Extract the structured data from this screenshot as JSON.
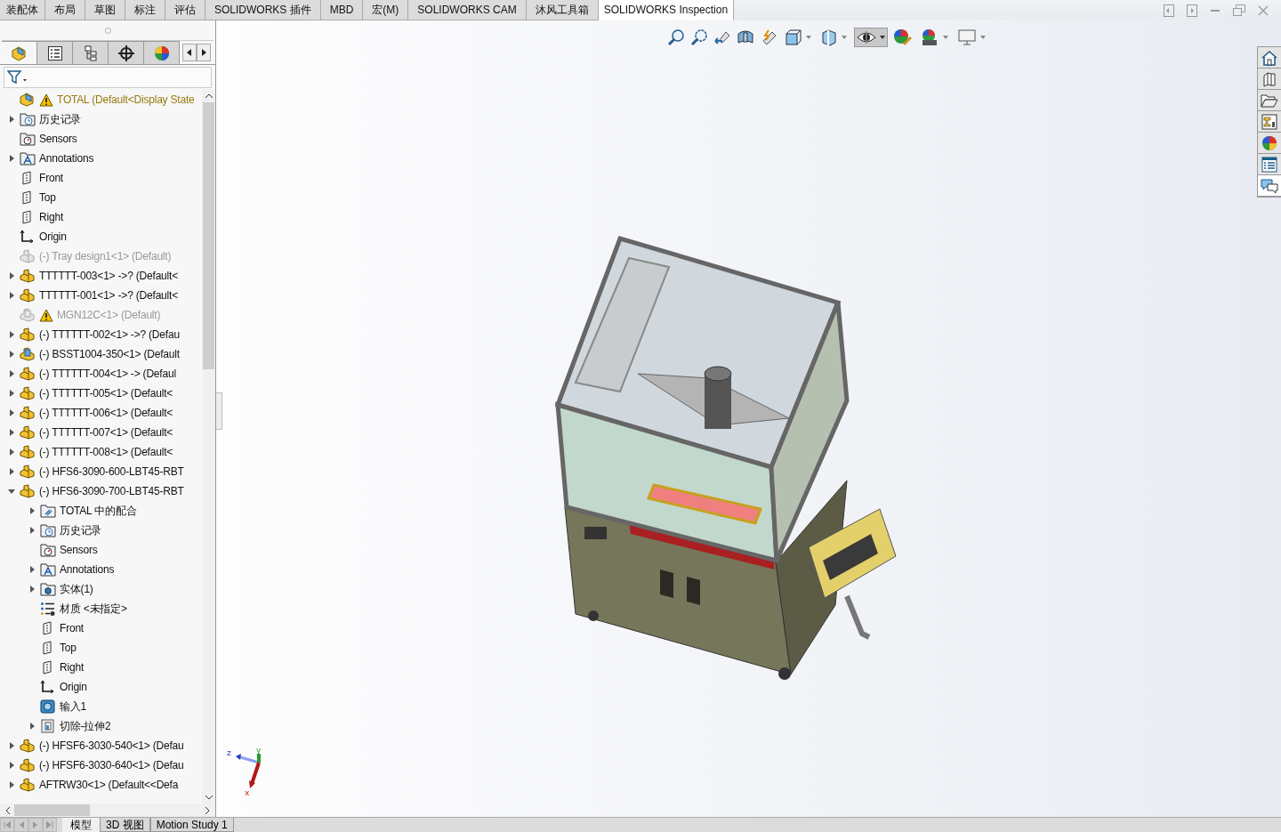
{
  "command_tabs": [
    {
      "label": "装配体",
      "selected": false
    },
    {
      "label": "布局",
      "selected": false
    },
    {
      "label": "草图",
      "selected": false
    },
    {
      "label": "标注",
      "selected": false
    },
    {
      "label": "评估",
      "selected": false
    },
    {
      "label": "SOLIDWORKS 插件",
      "selected": false
    },
    {
      "label": "MBD",
      "selected": false
    },
    {
      "label": "宏(M)",
      "selected": false
    },
    {
      "label": "SOLIDWORKS CAM",
      "selected": false
    },
    {
      "label": "沐风工具箱",
      "selected": false
    },
    {
      "label": "SOLIDWORKS Inspection",
      "selected": true
    }
  ],
  "panel_tabs": [
    {
      "kind": "feature-manager",
      "selected": true
    },
    {
      "kind": "property-manager",
      "selected": false
    },
    {
      "kind": "configuration-manager",
      "selected": false
    },
    {
      "kind": "dimxpert",
      "selected": false
    },
    {
      "kind": "display-manager",
      "selected": false
    }
  ],
  "tree": [
    {
      "kind": "root",
      "label": "TOTAL  (Default<Display State",
      "warning": true,
      "suppressed": false
    },
    {
      "kind": "history",
      "label": "历史记录",
      "expanded": false,
      "warning": false,
      "suppressed": false
    },
    {
      "kind": "sensors",
      "label": "Sensors",
      "warning": false,
      "suppressed": false
    },
    {
      "kind": "annotations",
      "label": "Annotations",
      "expanded": false,
      "warning": false,
      "suppressed": false
    },
    {
      "kind": "plane",
      "label": "Front",
      "warning": false,
      "suppressed": false
    },
    {
      "kind": "plane",
      "label": "Top",
      "warning": false,
      "suppressed": false
    },
    {
      "kind": "plane",
      "label": "Right",
      "warning": false,
      "suppressed": false
    },
    {
      "kind": "origin",
      "label": "Origin",
      "warning": false,
      "suppressed": false
    },
    {
      "kind": "component",
      "label": "(-) Tray design1<1> (Default)",
      "warning": false,
      "suppressed": true
    },
    {
      "kind": "component",
      "label": "TTTTTT-003<1> ->? (Default<",
      "expanded": false,
      "warning": false,
      "suppressed": false
    },
    {
      "kind": "component",
      "label": "TTTTTT-001<1> ->? (Default<",
      "expanded": false,
      "warning": false,
      "suppressed": false
    },
    {
      "kind": "part",
      "label": "MGN12C<1> (Default)",
      "warning": true,
      "suppressed": true
    },
    {
      "kind": "component",
      "label": "(-) TTTTTT-002<1> ->? (Defau",
      "expanded": false,
      "warning": false,
      "suppressed": false
    },
    {
      "kind": "part",
      "label": "(-) BSST1004-350<1> (Default",
      "expanded": false,
      "warning": false,
      "suppressed": false
    },
    {
      "kind": "component",
      "label": "(-) TTTTTT-004<1> -> (Defaul",
      "expanded": false,
      "warning": false,
      "suppressed": false
    },
    {
      "kind": "component",
      "label": "(-) TTTTTT-005<1> (Default<",
      "expanded": false,
      "warning": false,
      "suppressed": false
    },
    {
      "kind": "component",
      "label": "(-) TTTTTT-006<1> (Default<",
      "expanded": false,
      "warning": false,
      "suppressed": false
    },
    {
      "kind": "component",
      "label": "(-) TTTTTT-007<1> (Default<",
      "expanded": false,
      "warning": false,
      "suppressed": false
    },
    {
      "kind": "component",
      "label": "(-) TTTTTT-008<1> (Default<",
      "expanded": false,
      "warning": false,
      "suppressed": false
    },
    {
      "kind": "component",
      "label": "(-) HFS6-3090-600-LBT45-RBT",
      "expanded": false,
      "warning": false,
      "suppressed": false
    },
    {
      "kind": "component",
      "label": "(-) HFS6-3090-700-LBT45-RBT",
      "expanded": true,
      "warning": false,
      "suppressed": false,
      "children": [
        {
          "kind": "mates",
          "label": "TOTAL 中的配合",
          "expanded": false,
          "warning": false,
          "suppressed": false
        },
        {
          "kind": "history",
          "label": "历史记录",
          "expanded": false,
          "warning": false,
          "suppressed": false
        },
        {
          "kind": "sensors",
          "label": "Sensors",
          "warning": false,
          "suppressed": false
        },
        {
          "kind": "annotations",
          "label": "Annotations",
          "expanded": false,
          "warning": false,
          "suppressed": false
        },
        {
          "kind": "solid-bodies",
          "label": "实体(1)",
          "expanded": false,
          "warning": false,
          "suppressed": false
        },
        {
          "kind": "material",
          "label": "材质 <未指定>",
          "warning": false,
          "suppressed": false
        },
        {
          "kind": "plane",
          "label": "Front",
          "warning": false,
          "suppressed": false
        },
        {
          "kind": "plane",
          "label": "Top",
          "warning": false,
          "suppressed": false
        },
        {
          "kind": "plane",
          "label": "Right",
          "warning": false,
          "suppressed": false
        },
        {
          "kind": "origin",
          "label": "Origin",
          "warning": false,
          "suppressed": false
        },
        {
          "kind": "import",
          "label": "输入1",
          "warning": false,
          "suppressed": false
        },
        {
          "kind": "cut",
          "label": "切除-拉伸2",
          "expanded": false,
          "warning": false,
          "suppressed": false
        }
      ]
    },
    {
      "kind": "component",
      "label": "(-) HFSF6-3030-540<1> (Defau",
      "expanded": false,
      "warning": false,
      "suppressed": false
    },
    {
      "kind": "component",
      "label": "(-) HFSF6-3030-640<1> (Defau",
      "expanded": false,
      "warning": false,
      "suppressed": false
    },
    {
      "kind": "component",
      "label": "AFTRW30<1> (Default<<Defa",
      "expanded": false,
      "warning": false,
      "suppressed": false
    }
  ],
  "bottom_tabs": [
    {
      "label": "模型",
      "selected": true
    },
    {
      "label": "3D 视图",
      "selected": false
    },
    {
      "label": "Motion Study 1",
      "selected": false
    }
  ],
  "triad": {
    "x": "x",
    "y": "y",
    "z": "z"
  },
  "task_pane": [
    {
      "kind": "home",
      "selected": false
    },
    {
      "kind": "library",
      "selected": false
    },
    {
      "kind": "explorer",
      "selected": false
    },
    {
      "kind": "palette",
      "selected": false
    },
    {
      "kind": "appearances",
      "selected": false
    },
    {
      "kind": "properties",
      "selected": false
    },
    {
      "kind": "forum",
      "selected": true
    }
  ]
}
